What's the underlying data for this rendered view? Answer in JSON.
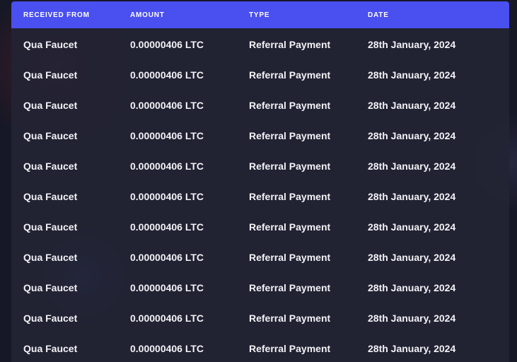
{
  "table": {
    "columns": [
      "RECEIVED FROM",
      "AMOUNT",
      "TYPE",
      "DATE"
    ],
    "rows": [
      {
        "from": "Qua Faucet",
        "amount": "0.00000406 LTC",
        "type": "Referral Payment",
        "date": "28th January, 2024"
      },
      {
        "from": "Qua Faucet",
        "amount": "0.00000406 LTC",
        "type": "Referral Payment",
        "date": "28th January, 2024"
      },
      {
        "from": "Qua Faucet",
        "amount": "0.00000406 LTC",
        "type": "Referral Payment",
        "date": "28th January, 2024"
      },
      {
        "from": "Qua Faucet",
        "amount": "0.00000406 LTC",
        "type": "Referral Payment",
        "date": "28th January, 2024"
      },
      {
        "from": "Qua Faucet",
        "amount": "0.00000406 LTC",
        "type": "Referral Payment",
        "date": "28th January, 2024"
      },
      {
        "from": "Qua Faucet",
        "amount": "0.00000406 LTC",
        "type": "Referral Payment",
        "date": "28th January, 2024"
      },
      {
        "from": "Qua Faucet",
        "amount": "0.00000406 LTC",
        "type": "Referral Payment",
        "date": "28th January, 2024"
      },
      {
        "from": "Qua Faucet",
        "amount": "0.00000406 LTC",
        "type": "Referral Payment",
        "date": "28th January, 2024"
      },
      {
        "from": "Qua Faucet",
        "amount": "0.00000406 LTC",
        "type": "Referral Payment",
        "date": "28th January, 2024"
      },
      {
        "from": "Qua Faucet",
        "amount": "0.00000406 LTC",
        "type": "Referral Payment",
        "date": "28th January, 2024"
      },
      {
        "from": "Qua Faucet",
        "amount": "0.00000406 LTC",
        "type": "Referral Payment",
        "date": "28th January, 2024"
      }
    ]
  },
  "colors": {
    "header_bg": "#4a4ff0",
    "panel_bg": "#222334",
    "page_bg": "#171826",
    "text": "#f2f2f6"
  }
}
